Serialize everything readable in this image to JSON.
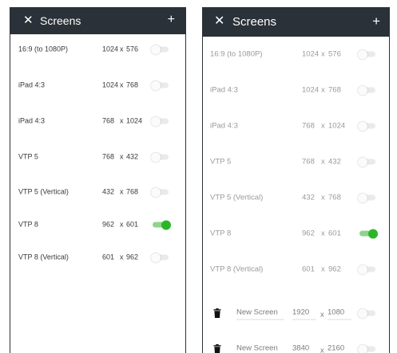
{
  "left_panel": {
    "title": "Screens",
    "close_glyph": "✕",
    "add_glyph": "+",
    "screens": [
      {
        "name": "16:9 (to 1080P)",
        "width": "1024",
        "sep": "x",
        "height": "576",
        "enabled": false
      },
      {
        "name": "iPad 4:3",
        "width": "1024",
        "sep": "x",
        "height": "768",
        "enabled": false
      },
      {
        "name": "iPad 4:3",
        "width": "768",
        "sep": "x",
        "height": "1024",
        "enabled": false
      },
      {
        "name": "VTP 5",
        "width": "768",
        "sep": "x",
        "height": "432",
        "enabled": false
      },
      {
        "name": "VTP 5 (Vertical)",
        "width": "432",
        "sep": "x",
        "height": "768",
        "enabled": false
      },
      {
        "name": "VTP 8",
        "width": "962",
        "sep": "x",
        "height": "601",
        "enabled": true
      },
      {
        "name": "VTP 8 (Vertical)",
        "width": "601",
        "sep": "x",
        "height": "962",
        "enabled": false
      }
    ]
  },
  "right_panel": {
    "title": "Screens",
    "close_glyph": "✕",
    "add_glyph": "+",
    "screens": [
      {
        "name": "16:9 (to 1080P)",
        "width": "1024",
        "sep": "x",
        "height": "576",
        "enabled": false
      },
      {
        "name": "iPad 4:3",
        "width": "1024",
        "sep": "x",
        "height": "768",
        "enabled": false
      },
      {
        "name": "iPad 4:3",
        "width": "768",
        "sep": "x",
        "height": "1024",
        "enabled": false
      },
      {
        "name": "VTP 5",
        "width": "768",
        "sep": "x",
        "height": "432",
        "enabled": false
      },
      {
        "name": "VTP 5 (Vertical)",
        "width": "432",
        "sep": "x",
        "height": "768",
        "enabled": false
      },
      {
        "name": "VTP 8",
        "width": "962",
        "sep": "x",
        "height": "601",
        "enabled": true
      },
      {
        "name": "VTP 8 (Vertical)",
        "width": "601",
        "sep": "x",
        "height": "962",
        "enabled": false
      }
    ],
    "new_screens": [
      {
        "name": "New Screen",
        "width": "1920",
        "sep": "x",
        "height": "1080",
        "enabled": false
      },
      {
        "name": "New Screen",
        "width": "3840",
        "sep": "x",
        "height": "2160",
        "enabled": false
      }
    ]
  },
  "colors": {
    "header_bg": "#2b3138",
    "toggle_on": "#2db52a",
    "toggle_track_on": "#8fd48b",
    "toggle_track_off": "#eaeaea"
  },
  "icons": {
    "close": "close-icon",
    "add": "plus-icon",
    "delete": "trash-icon"
  }
}
